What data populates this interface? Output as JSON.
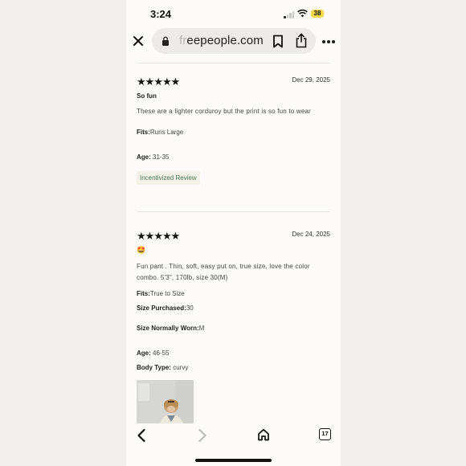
{
  "status_bar": {
    "time": "3:24",
    "battery": "38"
  },
  "browser": {
    "domain_faded": "fr",
    "domain_main": "eepeople.com",
    "tab_count": "17"
  },
  "reviews": [
    {
      "rating": 5,
      "date": "Dec 29, 2025",
      "title": "So fun",
      "text": "These are a lighter corduroy but the print is so fun to wear",
      "fits_label": "Fits:",
      "fits_value": "Runs Large",
      "age_label": "Age:",
      "age_value": "31-35",
      "badge": "Incentivized Review"
    },
    {
      "rating": 5,
      "date": "Dec 24, 2025",
      "title": "🤩",
      "text": "Fun pant . Thin, soft, easy put on, true size, love the color combo. 5'3\", 170lb, size 30(M)",
      "fits_label": "Fits:",
      "fits_value": "True to Size",
      "size_purchased_label": "Size Purchased:",
      "size_purchased_value": "30",
      "size_worn_label": "Size Normally Worn:",
      "size_worn_value": "M",
      "age_label": "Age:",
      "age_value": "46-55",
      "body_type_label": "Body Type:",
      "body_type_value": "curvy"
    }
  ],
  "icons": {
    "close": "close-icon",
    "lock": "lock-icon",
    "bookmark": "bookmark-icon",
    "share": "share-icon",
    "more": "more-icon",
    "back": "back-icon",
    "forward": "forward-icon",
    "home": "home-icon",
    "tabs": "tabs-icon"
  },
  "colors": {
    "badge_text": "#4a7a55",
    "page_bg": "#fdfbf9"
  }
}
